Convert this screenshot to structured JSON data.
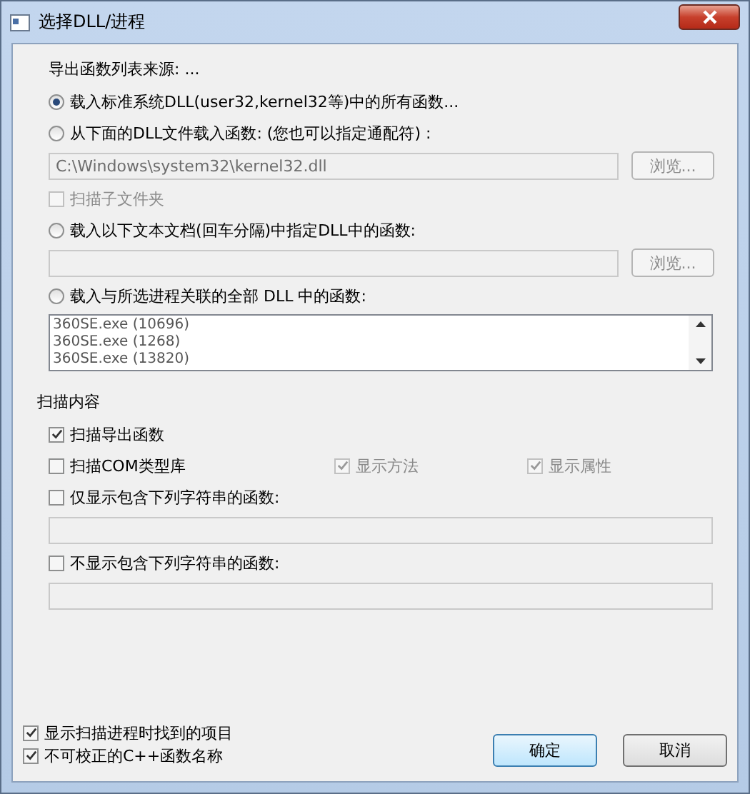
{
  "window": {
    "title": "选择DLL/进程"
  },
  "source": {
    "heading": "导出函数列表来源: ...",
    "rows": [
      {
        "kind": "radio",
        "label": "载入标准系统DLL(user32,kernel32等)中的所有函数...",
        "selected": true
      },
      {
        "kind": "radio",
        "label": "从下面的DLL文件载入函数: (您也可以指定通配符) :",
        "selected": false
      },
      {
        "kind": "path",
        "value": "C:\\Windows\\system32\\kernel32.dll",
        "button": "浏览...",
        "disabled": true
      },
      {
        "kind": "checkbox",
        "label": "扫描子文件夹",
        "checked": false,
        "disabled": true
      },
      {
        "kind": "radio",
        "label": "载入以下文本文档(回车分隔)中指定DLL中的函数:",
        "selected": false
      },
      {
        "kind": "path",
        "value": "",
        "button": "浏览...",
        "disabled": true
      },
      {
        "kind": "radio",
        "label": "载入与所选进程关联的全部 DLL 中的函数:",
        "selected": false
      },
      {
        "kind": "list",
        "items": [
          "360SE.exe (10696)",
          "360SE.exe (1268)",
          "360SE.exe (13820)"
        ]
      }
    ]
  },
  "scan": {
    "heading": "扫描内容",
    "rows": [
      {
        "kind": "checkbox",
        "label": "扫描导出函数",
        "checked": true,
        "disabled": false
      },
      {
        "kind": "checks",
        "items": [
          {
            "label": "扫描COM类型库",
            "checked": false,
            "disabled": false
          },
          {
            "label": "显示方法",
            "checked": true,
            "disabled": true
          },
          {
            "label": "显示属性",
            "checked": true,
            "disabled": true
          }
        ]
      },
      {
        "kind": "checkbox",
        "label": "仅显示包含下列字符串的函数:",
        "checked": false,
        "disabled": false
      },
      {
        "kind": "field",
        "value": "",
        "disabled": true
      },
      {
        "kind": "checkbox",
        "label": "不显示包含下列字符串的函数:",
        "checked": false,
        "disabled": false
      },
      {
        "kind": "field",
        "value": "",
        "disabled": true
      }
    ]
  },
  "options": [
    {
      "label": "显示扫描进程时找到的项目",
      "checked": true
    },
    {
      "label": "不可校正的C++函数名称",
      "checked": true
    }
  ],
  "buttons": [
    {
      "label": "确定",
      "default": true
    },
    {
      "label": "取消",
      "default": false
    }
  ]
}
